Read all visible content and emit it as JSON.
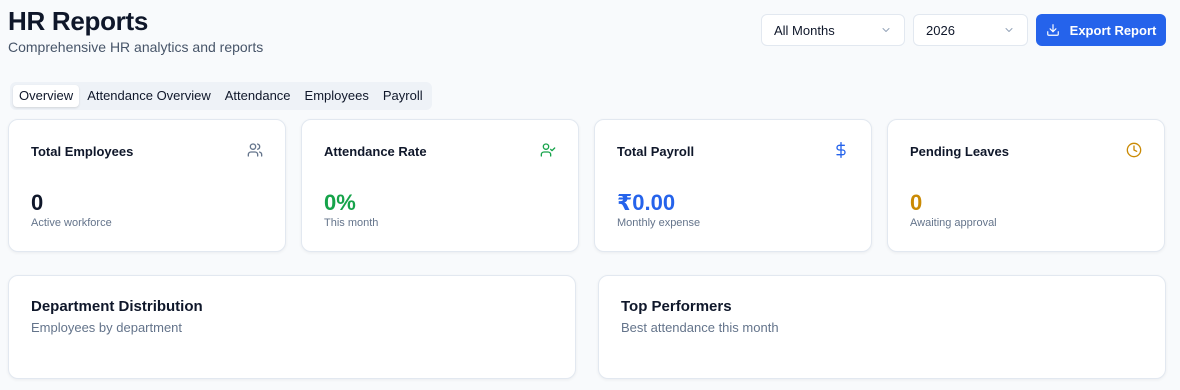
{
  "header": {
    "title": "HR Reports",
    "subtitle": "Comprehensive HR analytics and reports"
  },
  "controls": {
    "month": "All Months",
    "year": "2026",
    "export_label": "Export Report"
  },
  "tabs": [
    {
      "label": "Overview",
      "active": true
    },
    {
      "label": "Attendance Overview",
      "active": false
    },
    {
      "label": "Attendance",
      "active": false
    },
    {
      "label": "Employees",
      "active": false
    },
    {
      "label": "Payroll",
      "active": false
    }
  ],
  "stats": [
    {
      "label": "Total Employees",
      "value": "0",
      "desc": "Active workforce",
      "icon": "users-icon",
      "color": "#0f172a",
      "icon_color": "#64748b"
    },
    {
      "label": "Attendance Rate",
      "value": "0%",
      "desc": "This month",
      "icon": "user-check-icon",
      "color": "#16a34a",
      "icon_color": "#16a34a"
    },
    {
      "label": "Total Payroll",
      "value": "₹0.00",
      "desc": "Monthly expense",
      "icon": "dollar-icon",
      "color": "#2563eb",
      "icon_color": "#2563eb"
    },
    {
      "label": "Pending Leaves",
      "value": "0",
      "desc": "Awaiting approval",
      "icon": "clock-icon",
      "color": "#ca8a04",
      "icon_color": "#ca8a04"
    }
  ],
  "panels": {
    "department": {
      "title": "Department Distribution",
      "desc": "Employees by department"
    },
    "performers": {
      "title": "Top Performers",
      "desc": "Best attendance this month"
    }
  }
}
